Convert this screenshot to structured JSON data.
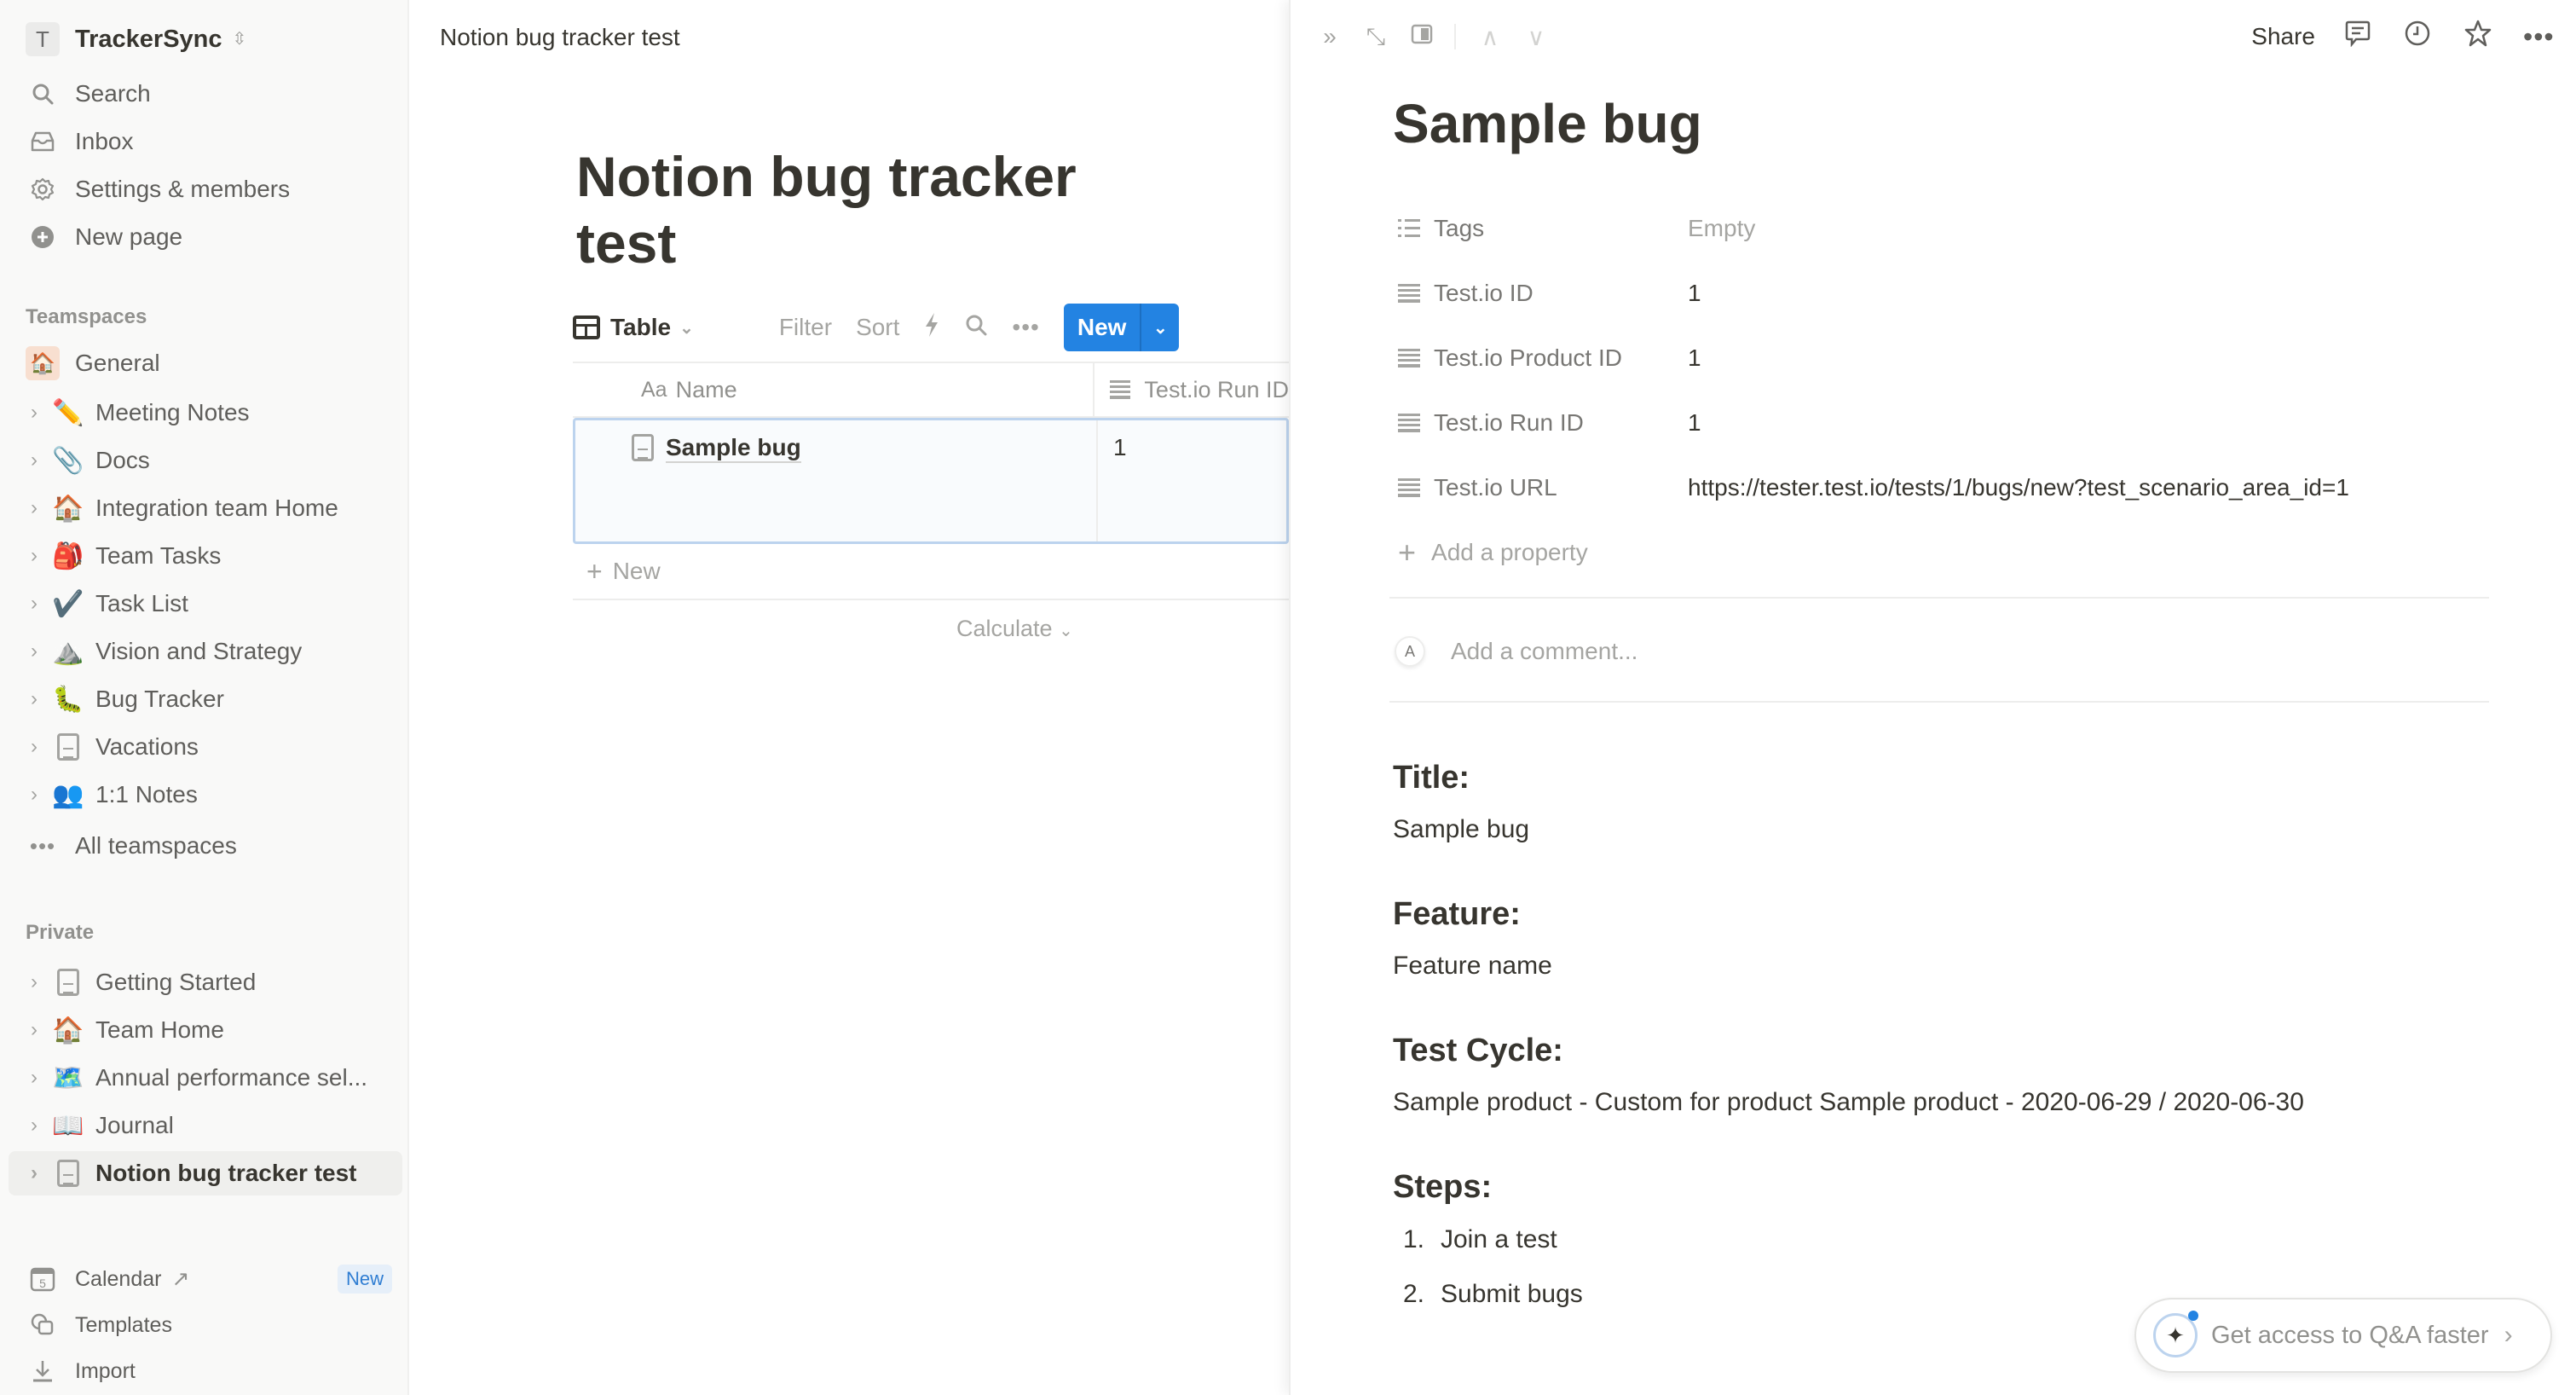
{
  "workspace": {
    "avatar_letter": "T",
    "name": "TrackerSync"
  },
  "sidebar": {
    "top_items": [
      {
        "label": "Search",
        "icon": "search-icon"
      },
      {
        "label": "Inbox",
        "icon": "inbox-icon"
      },
      {
        "label": "Settings & members",
        "icon": "gear-icon"
      },
      {
        "label": "New page",
        "icon": "plus-circle-icon"
      }
    ],
    "teamspaces_label": "Teamspaces",
    "general": {
      "label": "General",
      "icon": "🏠"
    },
    "teamspace_items": [
      {
        "label": "Meeting Notes",
        "emoji": "✏️"
      },
      {
        "label": "Docs",
        "emoji": "📎"
      },
      {
        "label": "Integration team Home",
        "emoji": "🏠"
      },
      {
        "label": "Team Tasks",
        "emoji": "🎒"
      },
      {
        "label": "Task List",
        "emoji": "✔️"
      },
      {
        "label": "Vision and Strategy",
        "emoji": "⛰️"
      },
      {
        "label": "Bug Tracker",
        "emoji": "🐛"
      },
      {
        "label": "Vacations",
        "emoji": "page-icon"
      },
      {
        "label": "1:1 Notes",
        "emoji": "👥"
      }
    ],
    "all_teamspaces": "All teamspaces",
    "private_label": "Private",
    "private_items": [
      {
        "label": "Getting Started",
        "emoji": "page-icon"
      },
      {
        "label": "Team Home",
        "emoji": "🏠"
      },
      {
        "label": "Annual performance sel...",
        "emoji": "🗺️"
      },
      {
        "label": "Journal",
        "emoji": "📖"
      },
      {
        "label": "Notion bug tracker test",
        "emoji": "page-icon",
        "active": true
      }
    ],
    "bottom_items": [
      {
        "label": "Calendar",
        "icon": "calendar-icon",
        "external": "↗",
        "badge": "New"
      },
      {
        "label": "Templates",
        "icon": "templates-icon"
      },
      {
        "label": "Import",
        "icon": "import-icon"
      }
    ]
  },
  "main": {
    "breadcrumb": "Notion bug tracker test",
    "title": "Notion bug tracker test",
    "toolbar": {
      "view_label": "Table",
      "filter": "Filter",
      "sort": "Sort",
      "new_label": "New"
    },
    "table": {
      "columns": [
        {
          "label": "Name",
          "prefix": "Aa"
        },
        {
          "label": "Test.io Run ID"
        }
      ],
      "rows": [
        {
          "name": "Sample bug",
          "run_id": "1"
        }
      ],
      "add_row_label": "New",
      "calculate_label": "Calculate"
    }
  },
  "panel": {
    "share_label": "Share",
    "title": "Sample bug",
    "properties": [
      {
        "name": "Tags",
        "value": "Empty",
        "empty": true,
        "icon": "multi-select-icon"
      },
      {
        "name": "Test.io ID",
        "value": "1",
        "icon": "text-icon"
      },
      {
        "name": "Test.io Product ID",
        "value": "1",
        "icon": "text-icon"
      },
      {
        "name": "Test.io Run ID",
        "value": "1",
        "icon": "text-icon"
      },
      {
        "name": "Test.io URL",
        "value": "https://tester.test.io/tests/1/bugs/new?test_scenario_area_id=1",
        "icon": "text-icon"
      }
    ],
    "add_property": "Add a property",
    "comment": {
      "avatar": "A",
      "placeholder": "Add a comment..."
    },
    "sections": [
      {
        "heading": "Title:",
        "text": "Sample bug"
      },
      {
        "heading": "Feature:",
        "text": "Feature name"
      },
      {
        "heading": "Test Cycle:",
        "text": "Sample product - Custom for product Sample product - 2020-06-29 / 2020-06-30"
      }
    ],
    "steps_heading": "Steps:",
    "steps": [
      "Join a test",
      "Submit bugs"
    ],
    "qa_prompt": "Get access to Q&A faster"
  },
  "colors": {
    "accent": "#2383e2",
    "text": "#37352f",
    "muted": "#91918e",
    "sidebar_bg": "#f9f9f8"
  }
}
